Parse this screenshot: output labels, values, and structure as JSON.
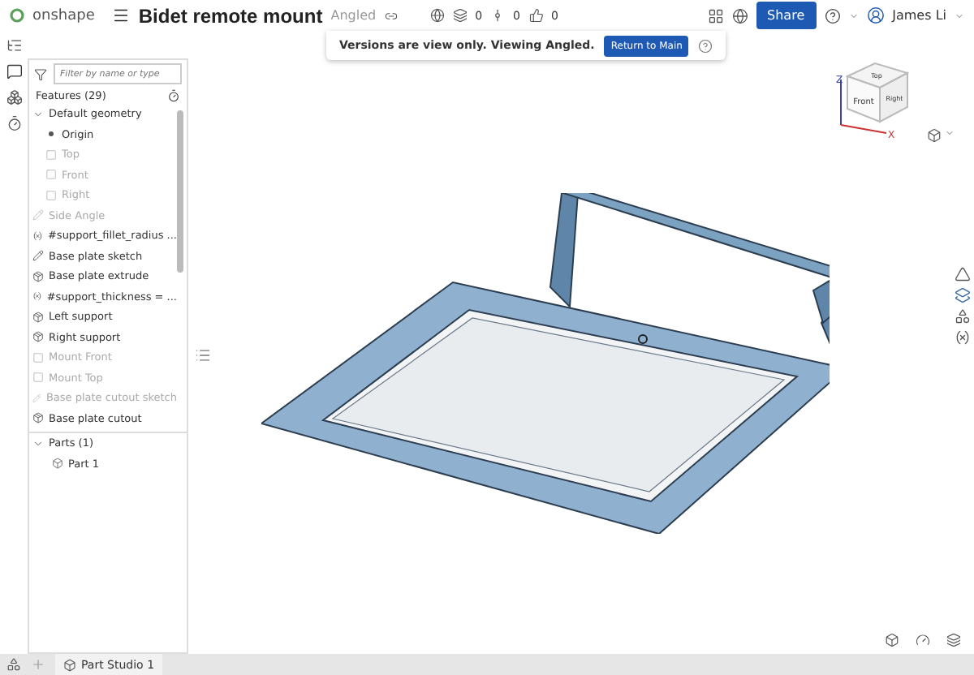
{
  "app": {
    "logo": "onshape",
    "title": "Bidet remote mount",
    "version": "Angled",
    "counts": [
      "0",
      "0",
      "0"
    ],
    "share": "Share",
    "user": "James Li"
  },
  "banner": {
    "message": "Versions are view only. Viewing Angled.",
    "button": "Return to Main"
  },
  "feature_panel": {
    "filter_placeholder": "Filter by name or type",
    "heading": "Features (29)",
    "features": [
      {
        "name": "Default geometry",
        "kind": "folder",
        "disabled": false,
        "expanded": true,
        "children": [
          {
            "name": "Origin",
            "kind": "origin",
            "disabled": false
          },
          {
            "name": "Top",
            "kind": "plane",
            "disabled": true
          },
          {
            "name": "Front",
            "kind": "plane",
            "disabled": true
          },
          {
            "name": "Right",
            "kind": "plane",
            "disabled": true
          }
        ]
      },
      {
        "name": "Side Angle",
        "kind": "sketch",
        "disabled": true
      },
      {
        "name": "#support_fillet_radius ...",
        "kind": "variable",
        "disabled": false
      },
      {
        "name": "Base plate sketch",
        "kind": "sketch",
        "disabled": false
      },
      {
        "name": "Base plate extrude",
        "kind": "extrude",
        "disabled": false
      },
      {
        "name": "#support_thickness = ...",
        "kind": "variable",
        "disabled": false
      },
      {
        "name": "Left support",
        "kind": "extrude",
        "disabled": false
      },
      {
        "name": "Right support",
        "kind": "extrude",
        "disabled": false
      },
      {
        "name": "Mount Front",
        "kind": "plane",
        "disabled": true
      },
      {
        "name": "Mount Top",
        "kind": "plane",
        "disabled": true
      },
      {
        "name": "Base plate cutout sketch",
        "kind": "sketch",
        "disabled": true
      },
      {
        "name": "Base plate cutout",
        "kind": "extrude",
        "disabled": false
      }
    ]
  },
  "parts": {
    "heading": "Parts (1)",
    "expanded": true,
    "items": [
      {
        "name": "Part 1"
      }
    ]
  },
  "view_cube": {
    "faces": [
      "Top",
      "Front",
      "Right"
    ],
    "axes": [
      "Z",
      "X"
    ]
  },
  "tabs": [
    {
      "label": "Part Studio 1",
      "selected": true
    }
  ]
}
